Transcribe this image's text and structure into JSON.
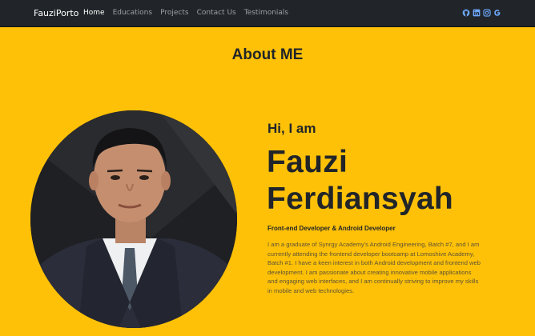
{
  "nav": {
    "brand": "FauziPorto",
    "links": [
      {
        "label": "Home",
        "active": true
      },
      {
        "label": "Educations",
        "active": false
      },
      {
        "label": "Projects",
        "active": false
      },
      {
        "label": "Contact Us",
        "active": false
      },
      {
        "label": "Testimonials",
        "active": false
      }
    ],
    "socials": [
      "github-icon",
      "linkedin-icon",
      "instagram-icon",
      "google-icon"
    ],
    "social_color": "#6ea8fe"
  },
  "about": {
    "title": "About ME",
    "greeting": "Hi, I am",
    "name_line1": "Fauzi",
    "name_line2": "Ferdiansyah",
    "role": "Front-end Developer & Android Developer",
    "bio": "I am a graduate of Synrgy Academy's Android Engineering, Batch #7, and I am currently attending the frontend developer bootcamp at Lomoshive Academy, Batch #1. I have a keen interest in both Android development and frontend web development. I am passionate about creating innovative mobile applications and engaging web interfaces, and I am continually striving to improve my skills in mobile and web technologies."
  },
  "colors": {
    "background": "#ffc107",
    "navbar": "#212529",
    "text": "#212529"
  }
}
